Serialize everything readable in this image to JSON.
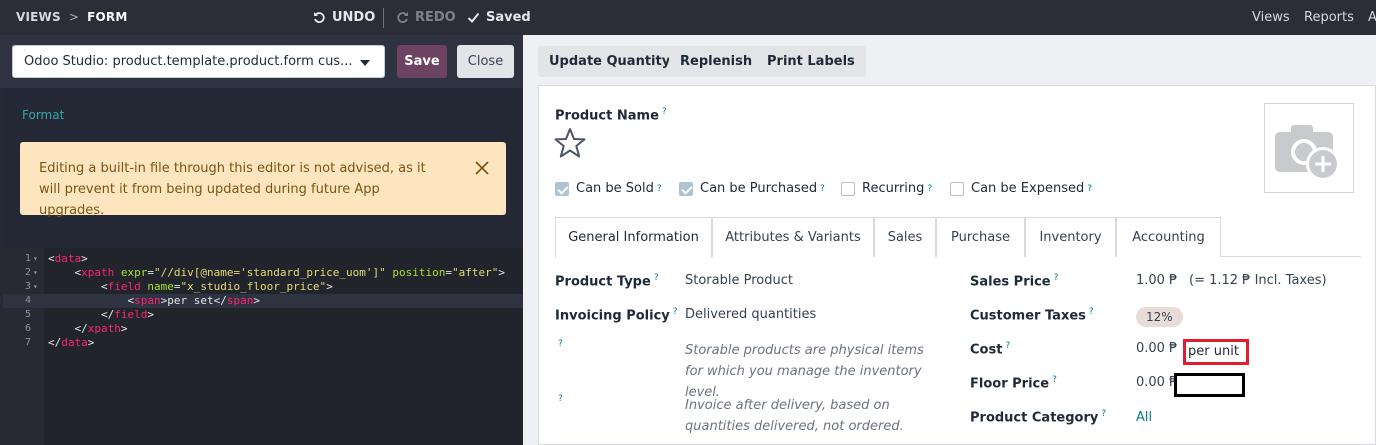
{
  "topbar": {
    "crumb_views": "VIEWS",
    "crumb_sep": ">",
    "crumb_form": "FORM",
    "undo": "UNDO",
    "redo": "REDO",
    "saved": "Saved",
    "views_link": "Views",
    "reports_link": "Reports",
    "cut_link": "A"
  },
  "editor": {
    "selected_view": "Odoo Studio: product.template.product.form cus...",
    "save_label": "Save",
    "close_label": "Close",
    "format_link": "Format",
    "alert_text": "Editing a built-in file through this editor is not advised, as it will prevent it from being updated during future App upgrades.",
    "code_lines": [
      {
        "num": "1",
        "fold": "▾",
        "indent": "",
        "parts": [
          [
            "br",
            "<"
          ],
          [
            "tag",
            "data"
          ],
          [
            "br",
            ">"
          ]
        ]
      },
      {
        "num": "2",
        "fold": "▾",
        "indent": "    ",
        "parts": [
          [
            "br",
            "<"
          ],
          [
            "tag",
            "xpath"
          ],
          [
            "br",
            " "
          ],
          [
            "attr",
            "expr"
          ],
          [
            "br",
            "="
          ],
          [
            "str",
            "\"//div[@name='standard_price_uom']\""
          ],
          [
            "br",
            " "
          ],
          [
            "attr",
            "position"
          ],
          [
            "br",
            "="
          ],
          [
            "str",
            "\"after\""
          ],
          [
            "br",
            ">"
          ]
        ]
      },
      {
        "num": "3",
        "fold": "▾",
        "indent": "        ",
        "parts": [
          [
            "br",
            "<"
          ],
          [
            "tag",
            "field"
          ],
          [
            "br",
            " "
          ],
          [
            "attr",
            "name"
          ],
          [
            "br",
            "="
          ],
          [
            "str",
            "\"x_studio_floor_price\""
          ],
          [
            "br",
            ">"
          ]
        ]
      },
      {
        "num": "4",
        "fold": "",
        "indent": "            ",
        "parts": [
          [
            "br",
            "<"
          ],
          [
            "tag",
            "span"
          ],
          [
            "br",
            ">per set</"
          ],
          [
            "tag",
            "span"
          ],
          [
            "br",
            ">"
          ]
        ]
      },
      {
        "num": "5",
        "fold": "",
        "indent": "        ",
        "parts": [
          [
            "br",
            "</"
          ],
          [
            "tag",
            "field"
          ],
          [
            "br",
            ">"
          ]
        ]
      },
      {
        "num": "6",
        "fold": "",
        "indent": "    ",
        "parts": [
          [
            "br",
            "</"
          ],
          [
            "tag",
            "xpath"
          ],
          [
            "br",
            ">"
          ]
        ]
      },
      {
        "num": "7",
        "fold": "",
        "indent": "",
        "parts": [
          [
            "br",
            "</"
          ],
          [
            "tag",
            "data"
          ],
          [
            "br",
            ">"
          ]
        ]
      }
    ]
  },
  "actions": {
    "update_quantity": "Update Quantity",
    "replenish": "Replenish",
    "print_labels": "Print Labels"
  },
  "product": {
    "name_label": "Product Name",
    "help_mark": "?",
    "checks": [
      {
        "label": "Can be Sold",
        "checked": true
      },
      {
        "label": "Can be Purchased",
        "checked": true
      },
      {
        "label": "Recurring",
        "checked": false
      },
      {
        "label": "Can be Expensed",
        "checked": false
      }
    ],
    "tabs": [
      "General Information",
      "Attributes & Variants",
      "Sales",
      "Purchase",
      "Inventory",
      "Accounting"
    ],
    "active_tab": "General Information",
    "left_fields": {
      "product_type_label": "Product Type",
      "product_type_value": "Storable Product",
      "invoicing_label": "Invoicing Policy",
      "invoicing_value": "Delivered quantities",
      "help_storable": "Storable products are physical items for which you manage the inventory level.",
      "help_invoice": "Invoice after delivery, based on quantities delivered, not ordered."
    },
    "right_fields": {
      "sales_price_label": "Sales Price",
      "sales_price_value": "1.00 ₱",
      "sales_price_incl": "(= 1.12 ₱ Incl. Taxes)",
      "taxes_label": "Customer Taxes",
      "taxes_badge": "12%",
      "cost_label": "Cost",
      "cost_value": "0.00 ₱",
      "cost_unit": "per unit",
      "floor_label": "Floor Price",
      "floor_value": "0.00 ₱",
      "category_label": "Product Category",
      "category_value": "All"
    }
  },
  "colors": {
    "topbar": "#2b2d37",
    "save_button": "#6c4361",
    "accent_teal": "#017e84",
    "alert_bg": "#fde6bf",
    "highlight_red": "#e11d2e"
  }
}
